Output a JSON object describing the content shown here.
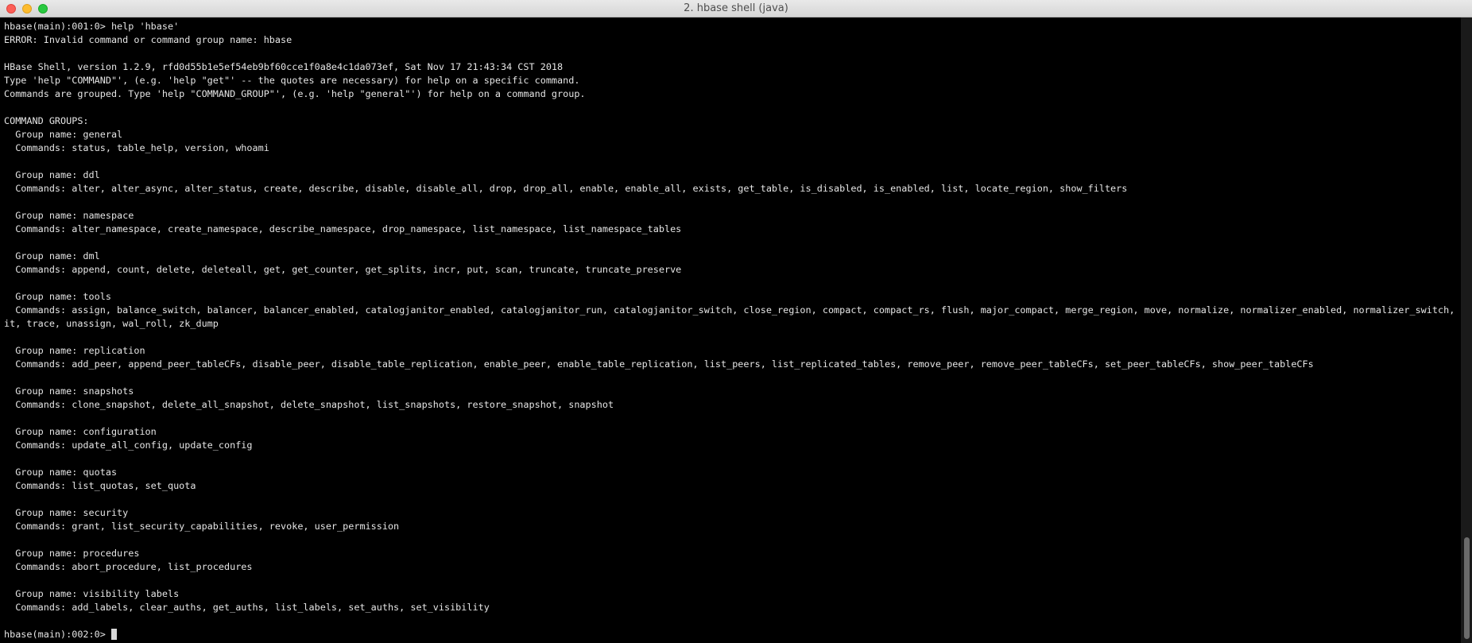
{
  "window": {
    "title": "2. hbase shell (java)"
  },
  "terminal": {
    "prompt1": "hbase(main):001:0> ",
    "command1": "help 'hbase'",
    "error": "ERROR: Invalid command or command group name: hbase",
    "version_line": "HBase Shell, version 1.2.9, rfd0d55b1e5ef54eb9bf60cce1f0a8e4c1da073ef, Sat Nov 17 21:43:34 CST 2018",
    "help_line_1": "Type 'help \"COMMAND\"', (e.g. 'help \"get\"' -- the quotes are necessary) for help on a specific command.",
    "help_line_2": "Commands are grouped. Type 'help \"COMMAND_GROUP\"', (e.g. 'help \"general\"') for help on a command group.",
    "groups_header": "COMMAND GROUPS:",
    "groups": [
      {
        "name": "  Group name: general",
        "commands": "  Commands: status, table_help, version, whoami"
      },
      {
        "name": "  Group name: ddl",
        "commands": "  Commands: alter, alter_async, alter_status, create, describe, disable, disable_all, drop, drop_all, enable, enable_all, exists, get_table, is_disabled, is_enabled, list, locate_region, show_filters"
      },
      {
        "name": "  Group name: namespace",
        "commands": "  Commands: alter_namespace, create_namespace, describe_namespace, drop_namespace, list_namespace, list_namespace_tables"
      },
      {
        "name": "  Group name: dml",
        "commands": "  Commands: append, count, delete, deleteall, get, get_counter, get_splits, incr, put, scan, truncate, truncate_preserve"
      },
      {
        "name": "  Group name: tools",
        "commands": "  Commands: assign, balance_switch, balancer, balancer_enabled, catalogjanitor_enabled, catalogjanitor_run, catalogjanitor_switch, close_region, compact, compact_rs, flush, major_compact, merge_region, move, normalize, normalizer_enabled, normalizer_switch, spl",
        "commands_wrap": "it, trace, unassign, wal_roll, zk_dump"
      },
      {
        "name": "  Group name: replication",
        "commands": "  Commands: add_peer, append_peer_tableCFs, disable_peer, disable_table_replication, enable_peer, enable_table_replication, list_peers, list_replicated_tables, remove_peer, remove_peer_tableCFs, set_peer_tableCFs, show_peer_tableCFs"
      },
      {
        "name": "  Group name: snapshots",
        "commands": "  Commands: clone_snapshot, delete_all_snapshot, delete_snapshot, list_snapshots, restore_snapshot, snapshot"
      },
      {
        "name": "  Group name: configuration",
        "commands": "  Commands: update_all_config, update_config"
      },
      {
        "name": "  Group name: quotas",
        "commands": "  Commands: list_quotas, set_quota"
      },
      {
        "name": "  Group name: security",
        "commands": "  Commands: grant, list_security_capabilities, revoke, user_permission"
      },
      {
        "name": "  Group name: procedures",
        "commands": "  Commands: abort_procedure, list_procedures"
      },
      {
        "name": "  Group name: visibility labels",
        "commands": "  Commands: add_labels, clear_auths, get_auths, list_labels, set_auths, set_visibility"
      }
    ],
    "prompt2": "hbase(main):002:0> "
  },
  "colors": {
    "background": "#000000",
    "text": "#e5e5e5",
    "titlebar": "#dcdcdc",
    "close": "#fc5f57",
    "minimize": "#fdbc2e",
    "maximize": "#28c840"
  }
}
